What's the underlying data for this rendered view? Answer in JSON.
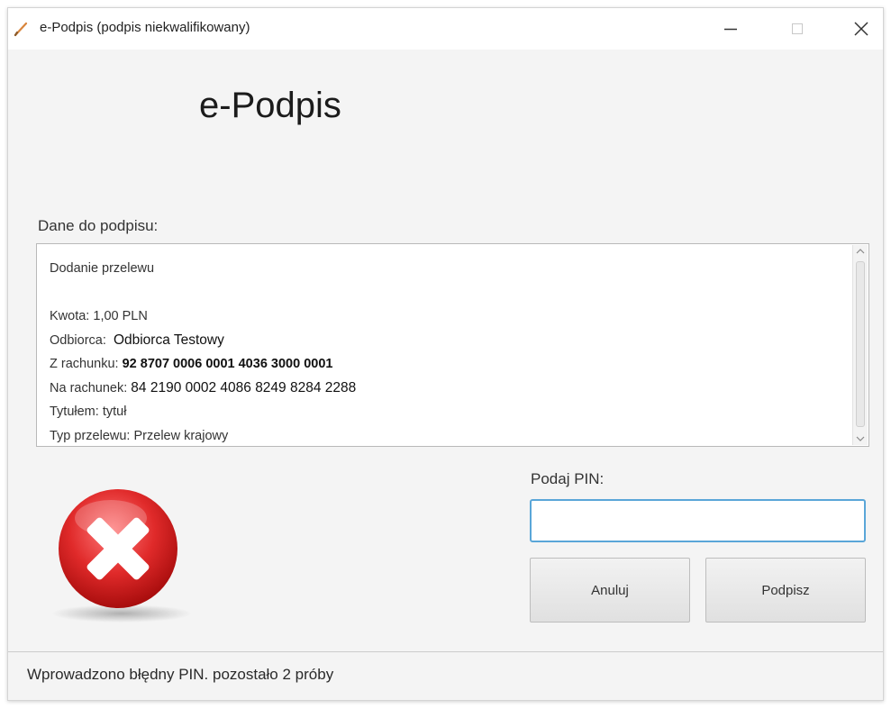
{
  "window": {
    "title": "e-Podpis (podpis niekwalifikowany)"
  },
  "header": {
    "title": "e-Podpis"
  },
  "sign_data": {
    "label": "Dane do podpisu:",
    "operation": "Dodanie przelewu",
    "amount_label": "Kwota:",
    "amount_value": "1,00 PLN",
    "recipient_label": "Odbiorca:",
    "recipient_value": "Odbiorca Testowy",
    "from_account_label": "Z rachunku:",
    "from_account_value": "92 8707 0006 0001 4036 3000 0001",
    "to_account_label": "Na rachunek:",
    "to_account_value": "84 2190 0002 4086 8249 8284 2288",
    "title_label": "Tytułem:",
    "title_value": "tytuł",
    "type_label": "Typ przelewu:",
    "type_value": "Przelew krajowy"
  },
  "pin": {
    "label": "Podaj PIN:",
    "value": "",
    "placeholder": ""
  },
  "buttons": {
    "cancel_label": "Anuluj",
    "sign_label": "Podpisz"
  },
  "status": {
    "message": "Wprowadzono błędny PIN. pozostało 2 próby"
  },
  "icons": {
    "app": "pen-icon",
    "error": "error-cross-icon"
  },
  "colors": {
    "error_red": "#e02a2a",
    "focus_blue": "#5aa6d8",
    "pen_orange": "#d9853b"
  }
}
